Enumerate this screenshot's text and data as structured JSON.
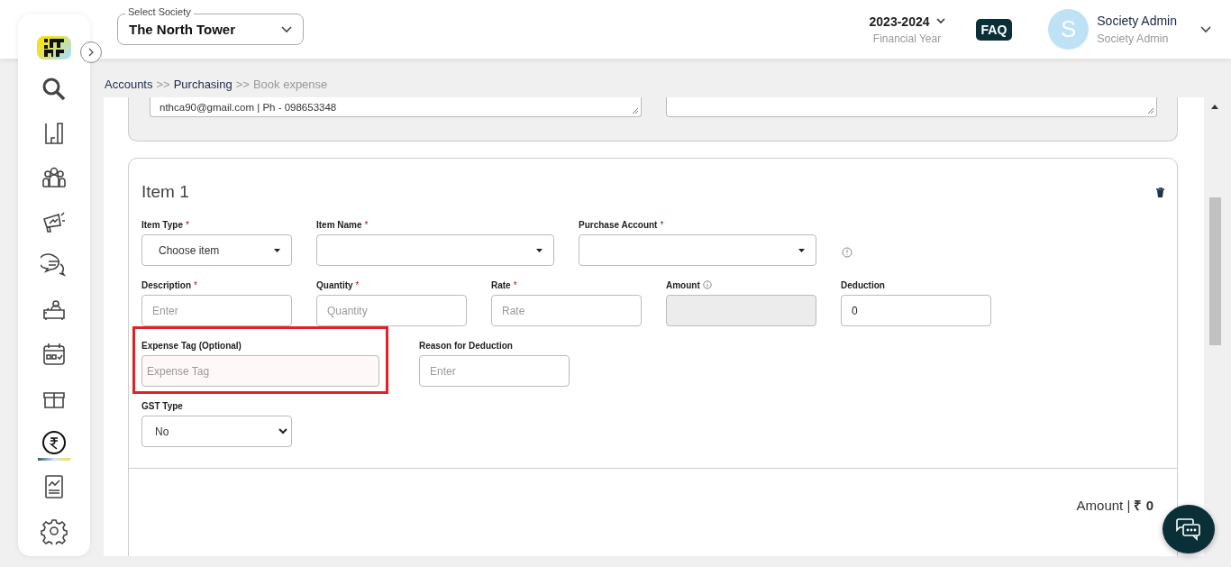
{
  "nav": [
    {
      "kind": "search",
      "selected": false
    },
    {
      "kind": "chart",
      "selected": false
    },
    {
      "kind": "people",
      "selected": false
    },
    {
      "kind": "megaphone",
      "selected": false
    },
    {
      "kind": "chat",
      "selected": false
    },
    {
      "kind": "desk",
      "selected": false
    },
    {
      "kind": "calendar",
      "selected": false
    },
    {
      "kind": "box",
      "selected": false
    },
    {
      "kind": "rupee",
      "selected": true
    },
    {
      "kind": "report",
      "selected": false
    },
    {
      "kind": "gear",
      "selected": false
    }
  ],
  "header": {
    "society_label": "Select Society",
    "society": "The North Tower",
    "year": "2023-2024",
    "year_caption": "Financial Year",
    "faq": "FAQ",
    "avatar_letter": "S",
    "user_name": "Society Admin",
    "user_role": "Society Admin"
  },
  "breadcrumb": [
    {
      "label": "Accounts",
      "current": false
    },
    {
      "label": "Purchasing",
      "current": false
    },
    {
      "label": "Book expense",
      "current": true
    }
  ],
  "breadcrumb_separators": [
    ">>",
    ">>"
  ],
  "contact_text": "nthca90@gmail.com | Ph - 098653348",
  "item": {
    "title": "Item 1",
    "rows": [
      [
        {
          "label": "Item Type",
          "required_mark": "*",
          "kind": "caret-select",
          "value": "Choose item"
        },
        {
          "label": "Item Name",
          "required_mark": "*",
          "kind": "caret-select"
        },
        {
          "label": "Purchase Account",
          "required_mark": "*",
          "kind": "caret-select",
          "info": true
        }
      ],
      [
        {
          "label": "Description",
          "required_mark": "*",
          "kind": "input",
          "placeholder": "Enter"
        },
        {
          "label": "Quantity",
          "required_mark": "*",
          "kind": "input",
          "placeholder": "Quantity"
        },
        {
          "label": "Rate",
          "required_mark": "*",
          "kind": "input",
          "placeholder": "Rate"
        },
        {
          "label": "Amount",
          "kind": "readonly",
          "info": true
        },
        {
          "label": "Deduction",
          "kind": "input",
          "value": "0"
        }
      ],
      [
        {
          "label": "Expense Tag (Optional)",
          "kind": "input",
          "placeholder": "Expense Tag",
          "highlighted": true
        },
        {
          "label": "Reason for Deduction",
          "kind": "input",
          "placeholder": "Enter"
        }
      ],
      [
        {
          "label": "GST Type",
          "kind": "select",
          "value": "No"
        }
      ]
    ],
    "total": "Amount | **₹ 0**"
  }
}
